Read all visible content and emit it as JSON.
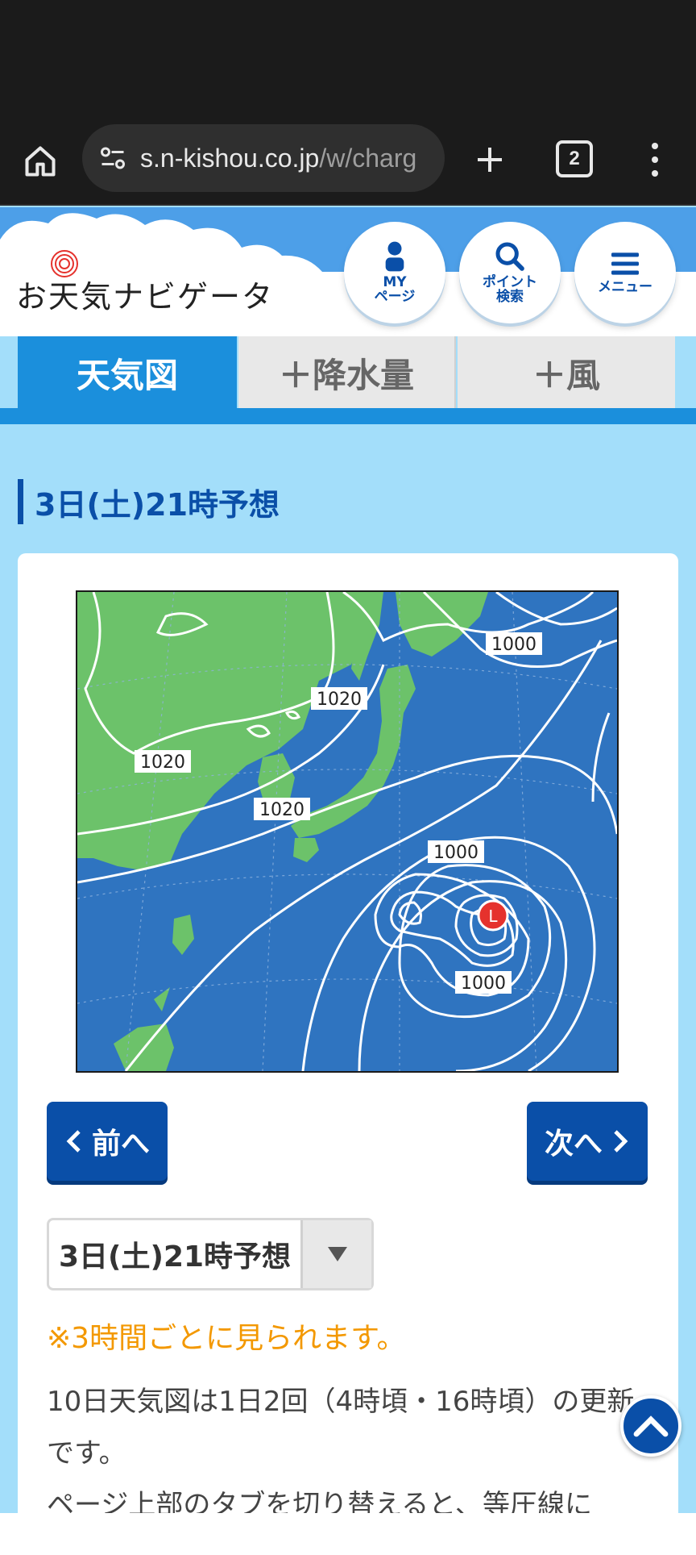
{
  "browser": {
    "url_host": "s.n-kishou.co.jp",
    "url_path": "/w/charg",
    "tab_count": "2"
  },
  "header": {
    "logo_text": "お天気ナビゲータ",
    "mypage_label_1": "MY",
    "mypage_label_2": "ページ",
    "search_label_1": "ポイント",
    "search_label_2": "検索",
    "menu_label": "メニュー"
  },
  "tabs": {
    "weather_map": "天気図",
    "precipitation": "＋降水量",
    "wind": "＋風"
  },
  "main": {
    "section_title": "3日(土)21時予想",
    "isobar_labels": {
      "a": "1000",
      "b": "1020",
      "c": "1020",
      "d": "1020",
      "e": "1000",
      "f": "1000"
    },
    "low_marker": "L",
    "prev_label": "前へ",
    "next_label": "次へ",
    "select_value": "3日(土)21時予想",
    "note": "※3時間ごとに見られます。",
    "body_line1": "10日天気図は1日2回（4時頃・16時頃）の更新です。",
    "body_line2": "ページ上部のタブを切り替えると、等圧線に"
  },
  "colors": {
    "brand_blue": "#0a4fa8",
    "tab_active": "#1b8fdc",
    "page_bg": "#a3defa",
    "land": "#6cc26a",
    "sea": "#2f74c0",
    "low_red": "#e5322d",
    "note_orange": "#f39800"
  }
}
